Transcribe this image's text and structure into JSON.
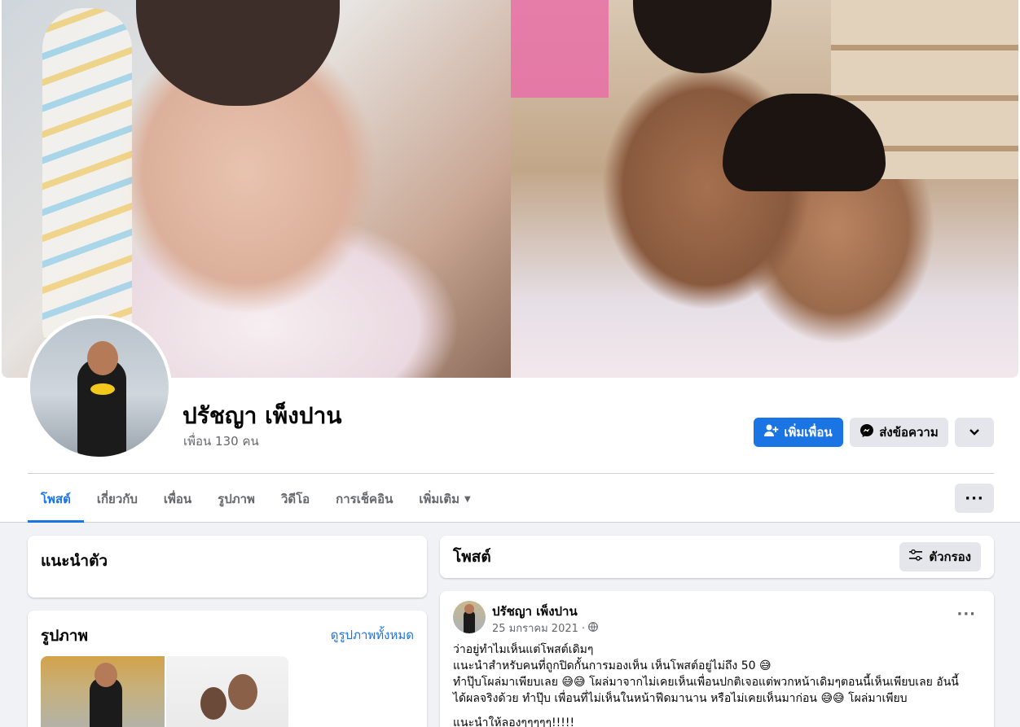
{
  "profile": {
    "name": "ปรัชญา เพ็งปาน",
    "friends_text": "เพื่อน 130 คน"
  },
  "actions": {
    "add_friend": "เพิ่มเพื่อน",
    "message": "ส่งข้อความ"
  },
  "tabs": [
    {
      "label": "โพสต์",
      "active": true
    },
    {
      "label": "เกี่ยวกับ"
    },
    {
      "label": "เพื่อน"
    },
    {
      "label": "รูปภาพ"
    },
    {
      "label": "วิดีโอ"
    },
    {
      "label": "การเช็คอิน"
    },
    {
      "label": "เพิ่มเติม"
    }
  ],
  "intro": {
    "title": "แนะนำตัว"
  },
  "photos": {
    "title": "รูปภาพ",
    "see_all": "ดูรูปภาพทั้งหมด"
  },
  "posts": {
    "title": "โพสต์",
    "filter": "ตัวกรอง"
  },
  "post": {
    "author": "ปรัชญา เพ็งปาน",
    "date": "25 มกราคม 2021 ·",
    "lines": [
      "ว่าอยู่ทำไมเห็นแต่โพสต์เดิมๆ",
      "แนะนำสำหรับคนที่ถูกปิดกั้นการมองเห็น  เห็นโพสต์อยู่ไม่ถึง 50 😅",
      "ทำปุ๊บโผล่มาเพียบเลย 😅😅 โผล่มาจากไม่เคยเห็นเพื่อนปกติเจอแต่พวกหน้าเดิมๆตอนนี้เห็นเพียบเลย อันนี้",
      "ได้ผลจริงด้วย ทำปุ๊บ เพื่อนที่ไม่เห็นในหน้าฟีดมานาน หรือไม่เคยเห็นมาก่อน 😅😅 โผล่มาเพียบ",
      "แนะนำให้ลองๆๆๆๆๆ!!!!!"
    ]
  },
  "colors": {
    "accent": "#1b74e4",
    "page_bg": "#f0f2f5"
  },
  "icons": [
    "add-friend-icon",
    "messenger-icon",
    "chevron-down-icon",
    "more-icon",
    "filter-icon",
    "globe-icon"
  ]
}
